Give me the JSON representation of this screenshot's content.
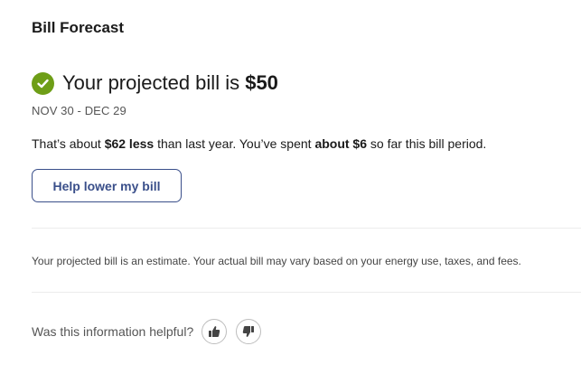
{
  "card": {
    "title": "Bill Forecast"
  },
  "projection": {
    "prefix": "Your projected bill is",
    "amount": "$50",
    "period": "NOV 30 - DEC 29",
    "status_icon": "check-circle-icon"
  },
  "summary": {
    "part1": "That’s about ",
    "less_amount": "$62 less",
    "part2": " than last year. You’ve spent ",
    "spent_amount": "about $6",
    "part3": " so far this bill period."
  },
  "actions": {
    "help_button_label": "Help lower my bill"
  },
  "disclaimer": "Your projected bill is an estimate. Your actual bill may vary based on your energy use, taxes, and fees.",
  "feedback": {
    "question": "Was this information helpful?",
    "thumbs_up_icon": "thumbs-up-icon",
    "thumbs_down_icon": "thumbs-down-icon"
  },
  "colors": {
    "accent": "#3a4f8a",
    "success": "#6e9e17",
    "text": "#1a1a1a",
    "muted": "#555555"
  }
}
